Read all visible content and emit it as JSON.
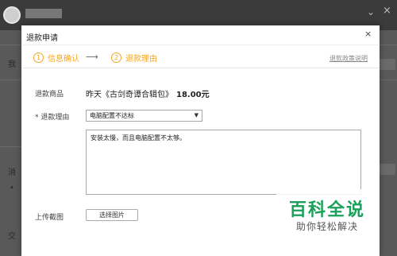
{
  "background": {
    "side_labels": [
      "我",
      "消",
      "交"
    ]
  },
  "dialog": {
    "title": "退款申请",
    "close_glyph": "×",
    "steps": [
      {
        "num": "1",
        "label": "信息确认"
      },
      {
        "num": "2",
        "label": "退款理由"
      }
    ],
    "step_arrow": "⟶",
    "policy_link": "退款政策说明",
    "product_label": "退款商品",
    "product_name": "昨天《古剑奇谭合辑包》",
    "product_price": "18.00元",
    "reason_label": "* 退款理由",
    "reason_selected": "电脑配置不达标",
    "reason_text": "安装太慢，而且电脑配置不太够。",
    "upload_label": "上传截图",
    "upload_button": "选择图片"
  },
  "watermark": {
    "title": "百科全说",
    "subtitle": "助你轻松解决"
  },
  "colors": {
    "accent": "#f5a623",
    "watermark_green": "#1aa05a"
  }
}
